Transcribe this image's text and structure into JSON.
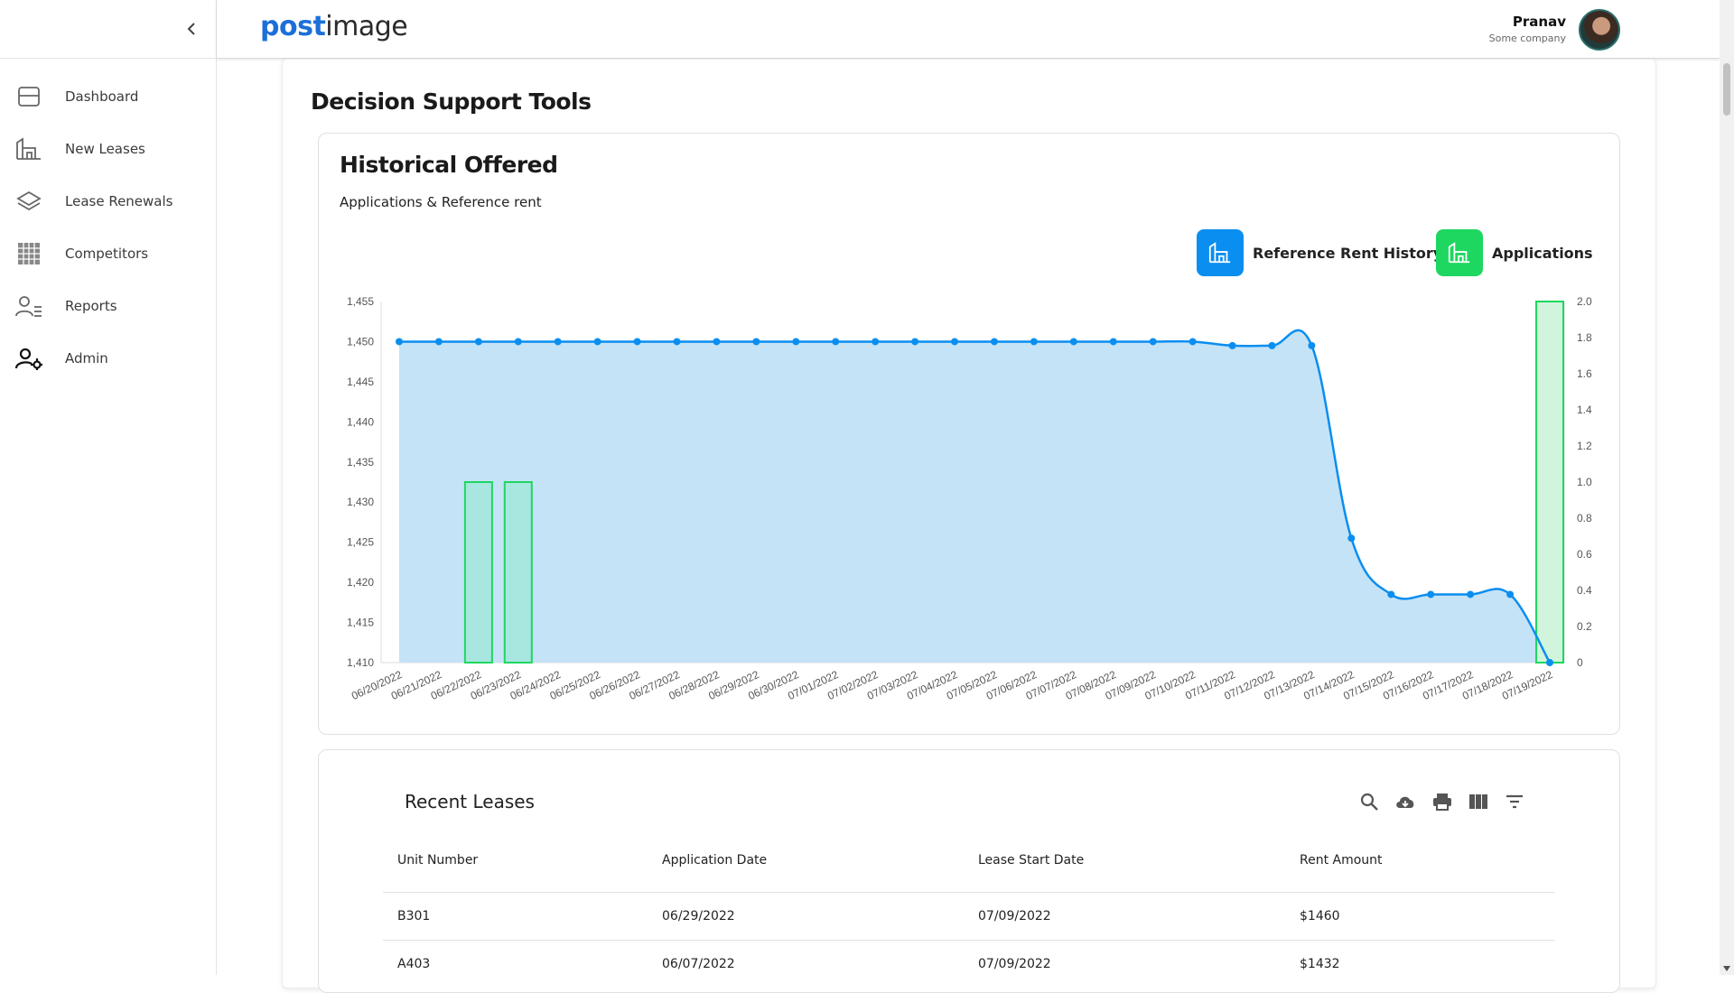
{
  "brand": {
    "logo_part1": "post",
    "logo_part2": "image"
  },
  "user": {
    "name": "Pranav",
    "company": "Some company"
  },
  "sidebar": {
    "items": [
      {
        "label": "Dashboard",
        "icon": "dashboard-icon"
      },
      {
        "label": "New Leases",
        "icon": "building-icon"
      },
      {
        "label": "Lease Renewals",
        "icon": "layers-icon"
      },
      {
        "label": "Competitors",
        "icon": "grid-icon"
      },
      {
        "label": "Reports",
        "icon": "user-list-icon"
      },
      {
        "label": "Admin",
        "icon": "user-gear-icon"
      }
    ]
  },
  "page": {
    "section_title": "Decision Support Tools"
  },
  "chart_panel": {
    "title": "Historical Offered",
    "subtitle": "Applications & Reference rent",
    "legend": [
      {
        "label": "Reference Rent History",
        "color": "#0a8ef0",
        "icon": "building-icon"
      },
      {
        "label": "Applications",
        "color": "#1ed760",
        "icon": "building-icon"
      }
    ]
  },
  "chart_data": {
    "type": "line",
    "categories": [
      "06/20/2022",
      "06/21/2022",
      "06/22/2022",
      "06/23/2022",
      "06/24/2022",
      "06/25/2022",
      "06/26/2022",
      "06/27/2022",
      "06/28/2022",
      "06/29/2022",
      "06/30/2022",
      "07/01/2022",
      "07/02/2022",
      "07/03/2022",
      "07/04/2022",
      "07/05/2022",
      "07/06/2022",
      "07/07/2022",
      "07/08/2022",
      "07/09/2022",
      "07/10/2022",
      "07/11/2022",
      "07/12/2022",
      "07/13/2022",
      "07/14/2022",
      "07/15/2022",
      "07/16/2022",
      "07/17/2022",
      "07/18/2022",
      "07/19/2022"
    ],
    "series": [
      {
        "name": "Reference Rent History",
        "type": "area",
        "axis": "left",
        "color": "#0a8ef0",
        "values": [
          1450,
          1450,
          1450,
          1450,
          1450,
          1450,
          1450,
          1450,
          1450,
          1450,
          1450,
          1450,
          1450,
          1450,
          1450,
          1450,
          1450,
          1450,
          1450,
          1450,
          1450,
          1449.5,
          1449.5,
          1449.5,
          1425.5,
          1418.5,
          1418.5,
          1418.5,
          1418.5,
          1410
        ]
      },
      {
        "name": "Applications",
        "type": "bar",
        "axis": "right",
        "color": "#1ed760",
        "values": [
          0,
          0,
          1,
          1,
          0,
          0,
          0,
          0,
          0,
          0,
          0,
          0,
          0,
          0,
          0,
          0,
          0,
          0,
          0,
          0,
          0,
          0,
          0,
          0,
          0,
          0,
          0,
          0,
          0,
          2
        ]
      }
    ],
    "y_left": {
      "min": 1410,
      "max": 1455,
      "ticks": [
        "1,410",
        "1,415",
        "1,420",
        "1,425",
        "1,430",
        "1,435",
        "1,440",
        "1,445",
        "1,450",
        "1,455"
      ]
    },
    "y_right": {
      "min": 0,
      "max": 2.0,
      "ticks": [
        "0",
        "0.2",
        "0.4",
        "0.6",
        "0.8",
        "1.0",
        "1.2",
        "1.4",
        "1.6",
        "1.8",
        "2.0"
      ]
    },
    "grid": false
  },
  "recent_leases": {
    "title": "Recent Leases",
    "tools": [
      "search-icon",
      "cloud-download-icon",
      "print-icon",
      "columns-icon",
      "filter-icon"
    ],
    "columns": [
      "Unit Number",
      "Application Date",
      "Lease Start Date",
      "Rent Amount"
    ],
    "rows": [
      [
        "B301",
        "06/29/2022",
        "07/09/2022",
        "$1460"
      ],
      [
        "A403",
        "06/07/2022",
        "07/09/2022",
        "$1432"
      ]
    ]
  }
}
